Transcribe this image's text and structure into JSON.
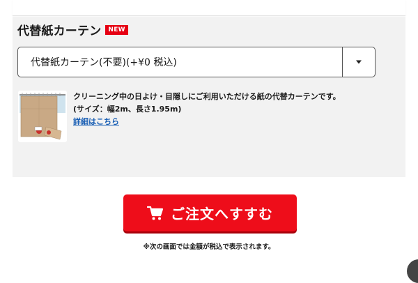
{
  "section": {
    "title": "代替紙カーテン",
    "badge": "NEW"
  },
  "select": {
    "value": "代替紙カーテン(不要)(+¥0 税込)"
  },
  "product": {
    "description": "クリーニング中の日よけ・目隠しにご利用いただける紙の代替カーテンです。",
    "size": "(サイズ：幅2m、長さ1.95m)",
    "details_link": "詳細はこちら"
  },
  "order": {
    "button_label": "ご注文へすすむ",
    "note": "※次の画面では金額が税込で表示されます。"
  },
  "colors": {
    "primary_red": "#ee0d1a",
    "badge_red": "#e60012",
    "link_blue": "#1a5fb4",
    "panel_bg": "#f2f2f2"
  },
  "icons": {
    "dropdown": "chevron-down-icon",
    "cart": "cart-icon"
  }
}
